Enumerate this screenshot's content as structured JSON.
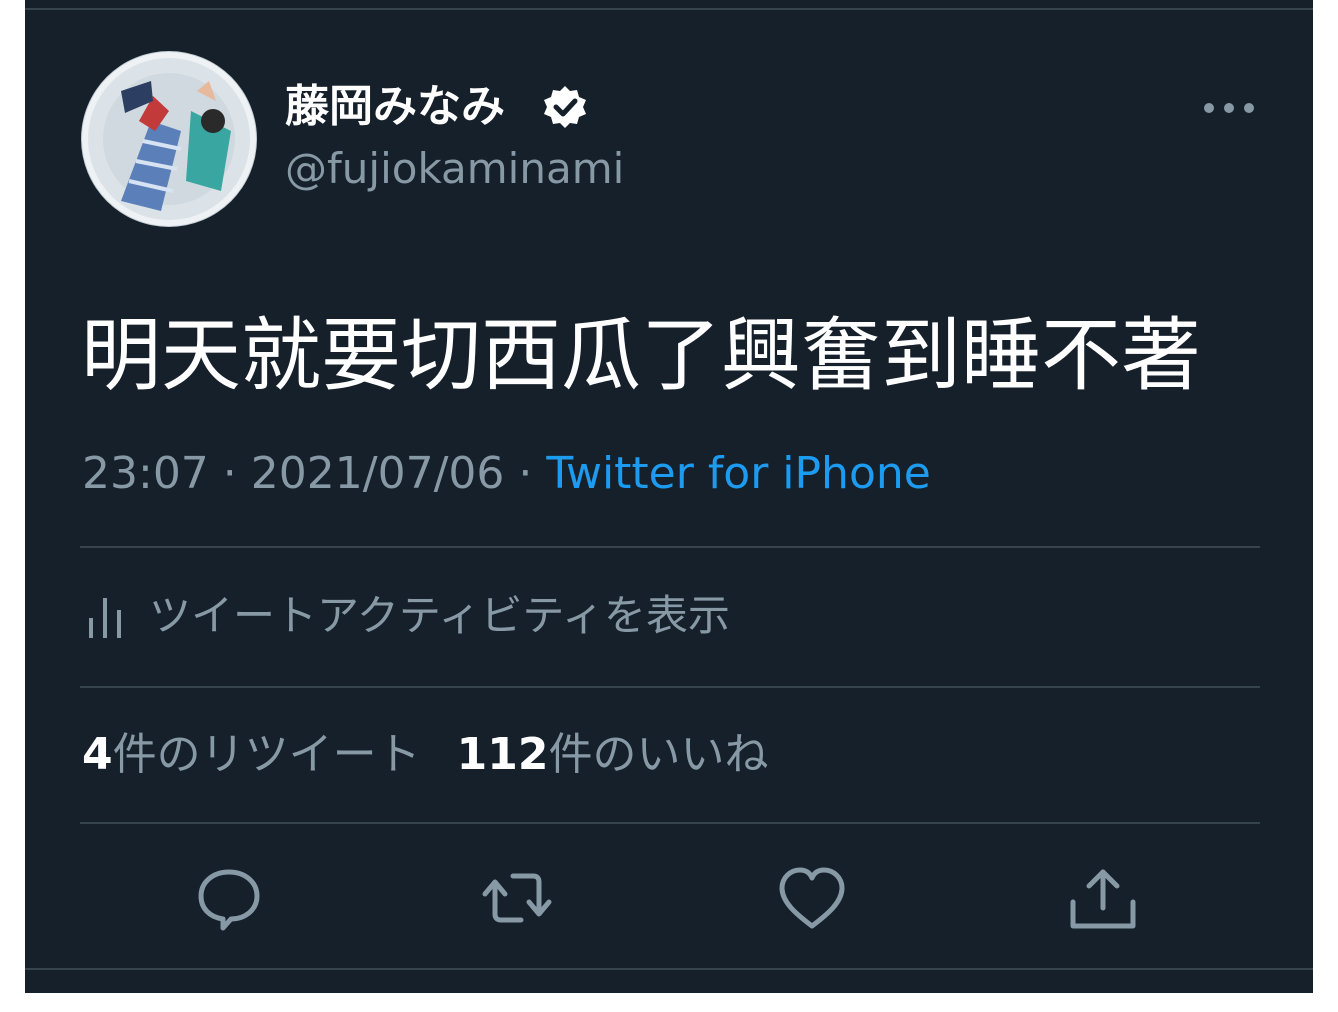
{
  "user": {
    "display_name": "藤岡みなみ",
    "handle": "@fujiokaminami",
    "verified_icon": "verified-badge-icon",
    "avatar_alt": "profile photo"
  },
  "tweet": {
    "text": "明天就要切西瓜了興奮到睡不著",
    "time": "23:07",
    "separator1": " · ",
    "date": "2021/07/06",
    "separator2": " · ",
    "source": "Twitter for iPhone"
  },
  "activity": {
    "label": "ツイートアクティビティを表示",
    "icon": "bar-chart-icon"
  },
  "stats": {
    "retweet_count": "4",
    "retweet_label": "件のリツイート",
    "like_count": "112",
    "like_label": "件のいいね"
  },
  "actions": [
    {
      "name": "reply",
      "icon": "reply-icon"
    },
    {
      "name": "retweet",
      "icon": "retweet-icon"
    },
    {
      "name": "like",
      "icon": "heart-icon"
    },
    {
      "name": "share",
      "icon": "share-icon"
    }
  ],
  "colors": {
    "background": "#15202b",
    "text_primary": "#ffffff",
    "text_secondary": "#8899a6",
    "accent": "#1d9bf0",
    "divider": "#38444d"
  }
}
